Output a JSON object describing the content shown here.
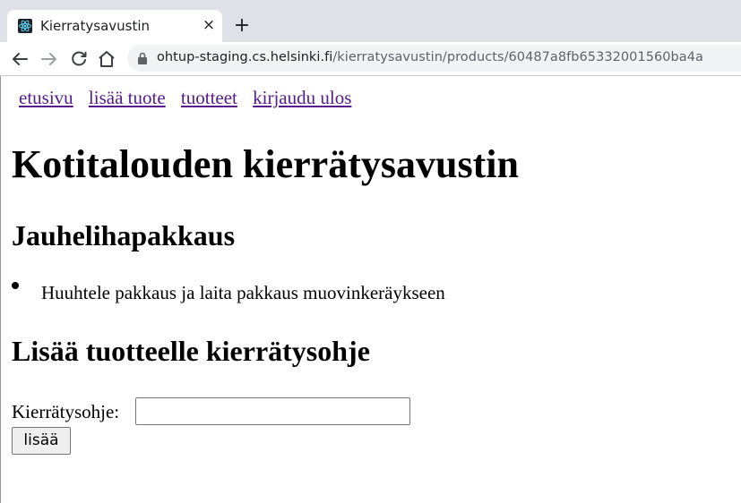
{
  "browser": {
    "tab_title": "Kierratysavustin",
    "tab_close_glyph": "×",
    "new_tab_glyph": "+",
    "url_host": "ohtup-staging.cs.helsinki.fi",
    "url_path": "/kierratysavustin/products/60487a8fb65332001560ba4a",
    "icons": {
      "favicon": "react-atom-icon",
      "back": "back-arrow-icon",
      "forward": "forward-arrow-icon",
      "reload": "reload-icon",
      "home": "home-icon",
      "lock": "lock-icon"
    }
  },
  "nav": {
    "links": [
      "etusivu",
      "lisää tuote",
      "tuotteet",
      "kirjaudu ulos"
    ],
    "link_color": "#551a8b"
  },
  "page": {
    "title": "Kotitalouden kierrätysavustin",
    "product_name": "Jauhelihapakkaus",
    "instructions": [
      "Huuhtele pakkaus ja laita pakkaus muovinkeräykseen"
    ],
    "form_heading": "Lisää tuotteelle kierrätysohje",
    "form": {
      "label": "Kierrätysohje:",
      "input_value": "",
      "submit_label": "lisää"
    }
  }
}
